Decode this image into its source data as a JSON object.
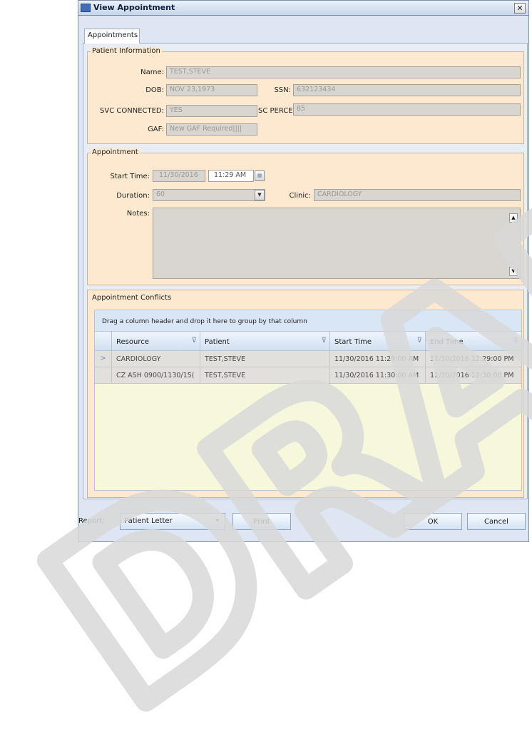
{
  "window": {
    "title": "View Appointment",
    "close_glyph": "✕"
  },
  "tabs": [
    {
      "label": "Appointments",
      "active": true
    }
  ],
  "patient_information": {
    "legend": "Patient Information",
    "name_label": "Name:",
    "name_value": "TEST,STEVE",
    "dob_label": "DOB:",
    "dob_value": "NOV 23,1973",
    "ssn_label": "SSN:",
    "ssn_value": "632123434",
    "svc_label": "SVC CONNECTED:",
    "svc_value": "YES",
    "sc_percent_label": "SC PERCENT:",
    "sc_percent_value": "85",
    "gaf_label": "GAF:",
    "gaf_value": "New GAF Required||||"
  },
  "appointment": {
    "legend": "Appointment",
    "start_time_label": "Start Time:",
    "start_date": "11/30/2016",
    "start_time": "11:29 AM",
    "duration_label": "Duration:",
    "duration_value": "60",
    "clinic_label": "Clinic:",
    "clinic_value": "CARDIOLOGY",
    "notes_label": "Notes:",
    "notes_value": ""
  },
  "conflicts": {
    "legend": "Appointment Conflicts",
    "group_hint": "Drag a column header and drop it here to group by that column",
    "columns": [
      "Resource",
      "Patient",
      "Start Time",
      "End Time"
    ],
    "rows": [
      {
        "indicator": ">",
        "cells": [
          "CARDIOLOGY",
          "TEST,STEVE",
          "11/30/2016 11:29:00 AM",
          "11/30/2016 12:29:00 PM"
        ]
      },
      {
        "indicator": "",
        "cells": [
          "CZ ASH 0900/1130/15(",
          "TEST,STEVE",
          "11/30/2016 11:30:00 AM",
          "11/30/2016 12:30:00 PM"
        ]
      }
    ]
  },
  "footer": {
    "report_label": "Report:",
    "report_value": "Patient Letter",
    "print_label": "Print",
    "ok_label": "OK",
    "cancel_label": "Cancel"
  },
  "watermark": {
    "text": "DRAFT"
  },
  "colors": {
    "group_bg": "#fde9cf",
    "field_bg": "#d9d6d1",
    "grid_bg": "#f7f7dc",
    "header_blue": "#d9e6f6"
  }
}
